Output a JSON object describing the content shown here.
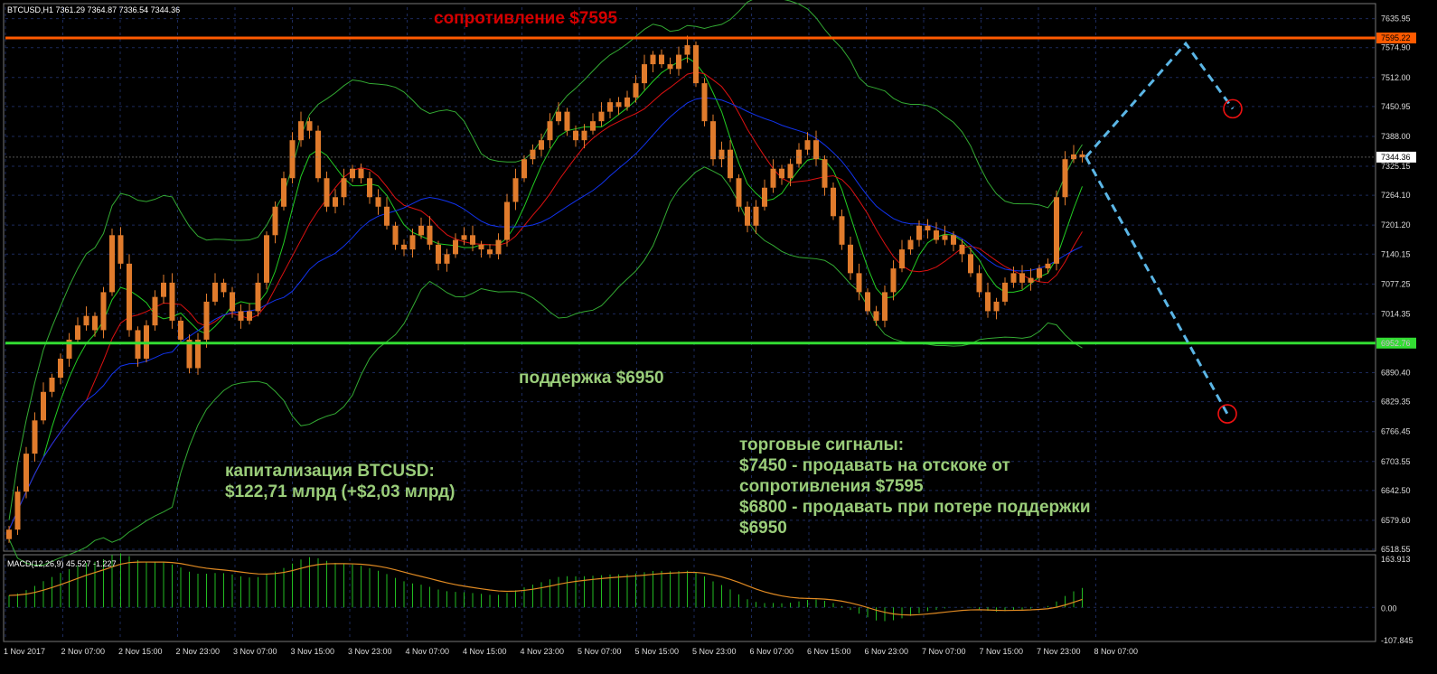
{
  "header": {
    "symbol_line": "BTCUSD,H1  7361.29 7364.87 7336.54 7344.36",
    "macd_line": "MACD(12,26,9) 45.527 -1.227"
  },
  "annotations": {
    "resistance": "сопротивление $7595",
    "support": "поддержка $6950",
    "cap_line1": "капитализация BTCUSD:",
    "cap_line2": "$122,71 млрд (+$2,03 млрд)",
    "signals": [
      "торговые сигналы:",
      "$7450 - продавать на отскоке от",
      "сопротивления $7595",
      "$6800 - продавать при потере поддержки",
      "$6950"
    ]
  },
  "colors": {
    "background": "#000000",
    "grid": "#1c2a5c",
    "candle": "#e07b2c",
    "resistance": "#ff5a00",
    "support": "#33dd33",
    "bands": "#33aa33",
    "ma_fast": "#22cc22",
    "ma_mid": "#dd1111",
    "ma_slow": "#1133ee",
    "forecast": "#5bb6e6",
    "macd_hist": "#22bb22",
    "macd_signal": "#e08a22"
  },
  "chart_data": {
    "type": "candlestick",
    "symbol": "BTCUSD",
    "timeframe": "H1",
    "ylim": [
      6518.55,
      7660
    ],
    "y_ticks": [
      7635.95,
      7574.9,
      7512.0,
      7450.95,
      7388.0,
      7325.15,
      7264.1,
      7201.2,
      7140.15,
      7077.25,
      7014.35,
      6952.76,
      6890.4,
      6829.35,
      6766.45,
      6703.55,
      6642.5,
      6579.6,
      6518.55
    ],
    "x_ticks": [
      "1 Nov 2017",
      "2 Nov 07:00",
      "2 Nov 15:00",
      "2 Nov 23:00",
      "3 Nov 07:00",
      "3 Nov 15:00",
      "3 Nov 23:00",
      "4 Nov 07:00",
      "4 Nov 15:00",
      "4 Nov 23:00",
      "5 Nov 07:00",
      "5 Nov 15:00",
      "5 Nov 23:00",
      "6 Nov 07:00",
      "6 Nov 15:00",
      "6 Nov 23:00",
      "7 Nov 07:00",
      "7 Nov 15:00",
      "7 Nov 23:00",
      "8 Nov 07:00"
    ],
    "current_price": 7344.36,
    "resistance": 7595.22,
    "support": 6952.76,
    "close_series": [
      6560,
      6640,
      6720,
      6790,
      6850,
      6880,
      6920,
      6960,
      6990,
      7010,
      6980,
      7060,
      7180,
      7120,
      6980,
      6920,
      6990,
      7050,
      7080,
      7000,
      6960,
      6900,
      6960,
      7040,
      7080,
      7060,
      7020,
      7000,
      7020,
      7080,
      7180,
      7240,
      7300,
      7380,
      7420,
      7400,
      7300,
      7240,
      7260,
      7300,
      7320,
      7300,
      7260,
      7240,
      7200,
      7160,
      7150,
      7180,
      7200,
      7160,
      7120,
      7140,
      7170,
      7180,
      7160,
      7150,
      7140,
      7170,
      7250,
      7300,
      7340,
      7360,
      7380,
      7420,
      7440,
      7400,
      7380,
      7400,
      7420,
      7440,
      7460,
      7450,
      7470,
      7500,
      7540,
      7560,
      7540,
      7530,
      7560,
      7580,
      7500,
      7420,
      7340,
      7360,
      7300,
      7240,
      7200,
      7240,
      7280,
      7320,
      7300,
      7330,
      7360,
      7380,
      7340,
      7280,
      7220,
      7160,
      7100,
      7060,
      7020,
      7000,
      7060,
      7110,
      7150,
      7170,
      7200,
      7190,
      7170,
      7180,
      7160,
      7140,
      7100,
      7060,
      7020,
      7040,
      7080,
      7100,
      7080,
      7090,
      7110,
      7120,
      7260,
      7340,
      7350,
      7344
    ],
    "forecast": {
      "start": 7344.36,
      "bounce_peak": 7595,
      "target_sell_bounce": 7450,
      "target_sell_break": 6800
    },
    "macd": {
      "name": "MACD(12,26,9)",
      "main": 45.527,
      "signal": -1.227,
      "ylim": [
        -107.845,
        163.913
      ],
      "y_ticks": [
        163.913,
        0.0,
        -107.845
      ]
    }
  }
}
